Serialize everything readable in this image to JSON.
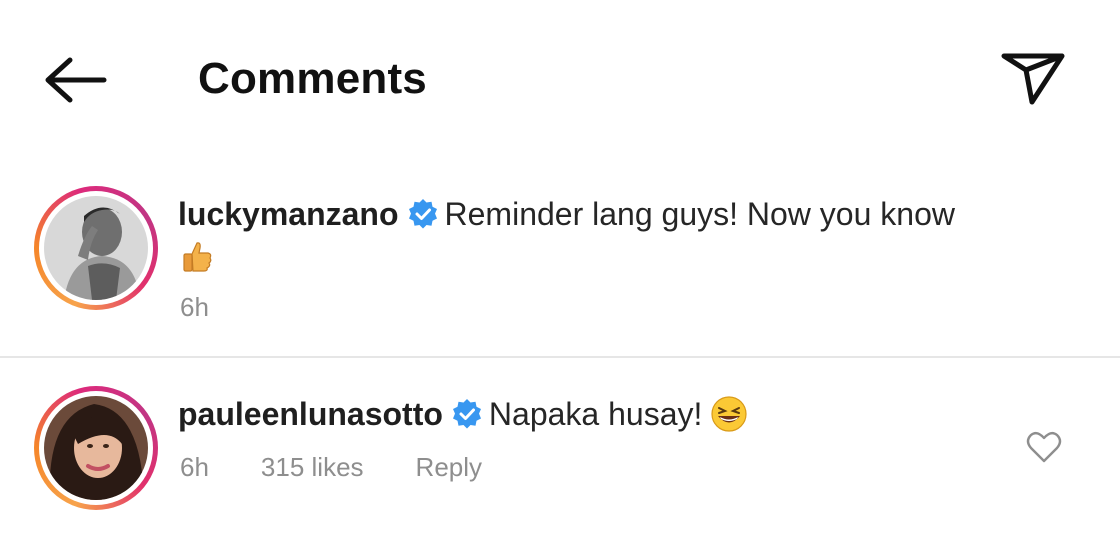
{
  "header": {
    "title": "Comments",
    "back_icon": "arrow-left-icon",
    "send_icon": "paper-plane-icon"
  },
  "comments": [
    {
      "username": "luckymanzano",
      "verified": true,
      "text": "Reminder lang guys! Now you know",
      "emoji": "thumbs-up",
      "time": "6h"
    },
    {
      "username": "pauleenlunasotto",
      "verified": true,
      "text": "Napaka husay!",
      "emoji": "grinning-squinting-face",
      "time": "6h",
      "likes": "315 likes",
      "reply": "Reply"
    }
  ],
  "colors": {
    "verified_blue": "#3897f0",
    "meta_gray": "#8e8e8e",
    "divider": "#e6e6e6"
  }
}
